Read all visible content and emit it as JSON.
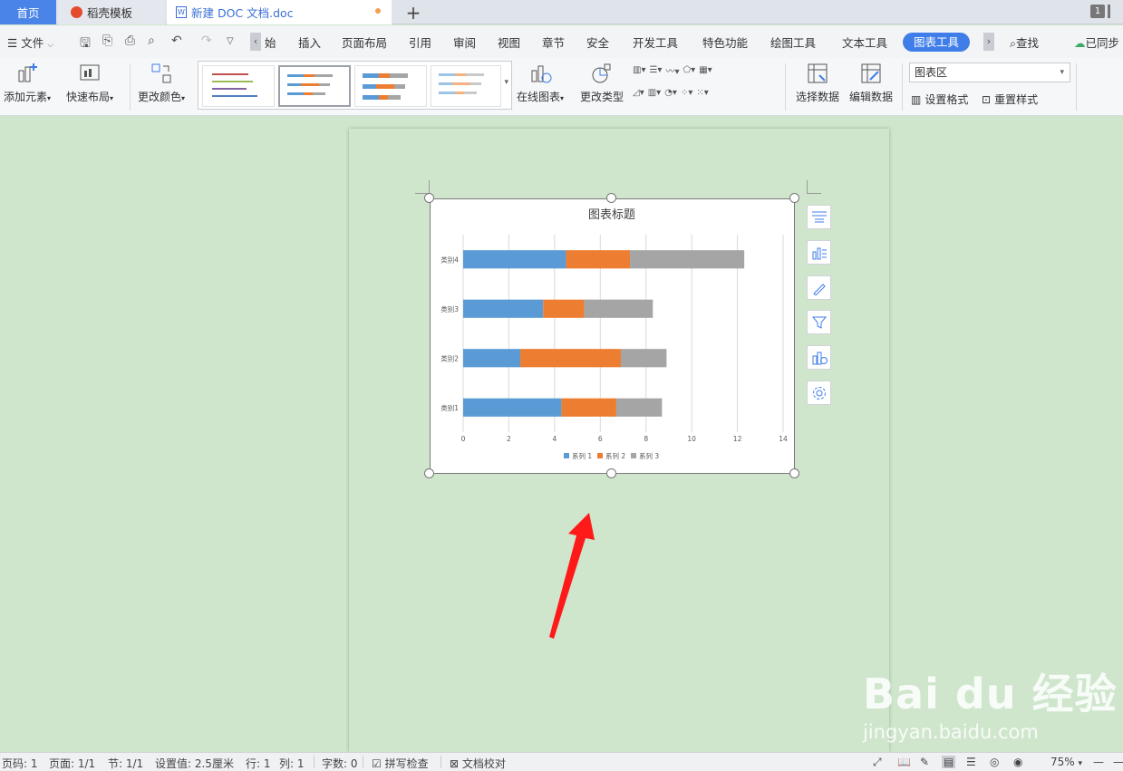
{
  "tabs": {
    "home": "首页",
    "template": "稻壳模板",
    "document": "新建 DOC 文档.doc",
    "add": "+",
    "window_count": "1"
  },
  "menu": {
    "file": "文件",
    "truncated_start": "始",
    "items": [
      "插入",
      "页面布局",
      "引用",
      "审阅",
      "视图",
      "章节",
      "安全",
      "开发工具",
      "特色功能",
      "绘图工具",
      "文本工具"
    ],
    "active": "图表工具",
    "search": "查找",
    "sync": "已同步"
  },
  "ribbon": {
    "add_element": "添加元素",
    "quick_layout": "快速布局",
    "change_color": "更改颜色",
    "online_chart": "在线图表",
    "change_type": "更改类型",
    "select_data": "选择数据",
    "edit_data": "编辑数据",
    "chart_area_select": "图表区",
    "set_format": "设置格式",
    "reset_style": "重置样式"
  },
  "chart_data": {
    "type": "bar",
    "orientation": "horizontal",
    "stacked": true,
    "title": "图表标题",
    "categories": [
      "类别1",
      "类别2",
      "类别3",
      "类别4"
    ],
    "series": [
      {
        "name": "系列 1",
        "values": [
          4.3,
          2.5,
          3.5,
          4.5
        ],
        "color": "#5b9bd5"
      },
      {
        "name": "系列 2",
        "values": [
          2.4,
          4.4,
          1.8,
          2.8
        ],
        "color": "#ed7d31"
      },
      {
        "name": "系列 3",
        "values": [
          2.0,
          2.0,
          3.0,
          5.0
        ],
        "color": "#a5a5a5"
      }
    ],
    "xlim": [
      0,
      14
    ],
    "xticks": [
      "0",
      "2",
      "4",
      "6",
      "8",
      "10",
      "12",
      "14"
    ],
    "grid": true,
    "legend": "bottom"
  },
  "status": {
    "page_code": "页码: 1",
    "pages": "页面: 1/1",
    "section": "节: 1/1",
    "setting": "设置值: 2.5厘米",
    "row": "行: 1",
    "col": "列: 1",
    "word_count": "字数: 0",
    "spell_check": "拼写检查",
    "proofread": "文档校对",
    "zoom": "75%"
  },
  "watermark": {
    "logo": "Bai du 经验",
    "url": "jingyan.baidu.com"
  },
  "colors": {
    "accent": "#3f7ee8",
    "page_bg": "#cfe6cc",
    "arrow": "#ff1a1a"
  }
}
